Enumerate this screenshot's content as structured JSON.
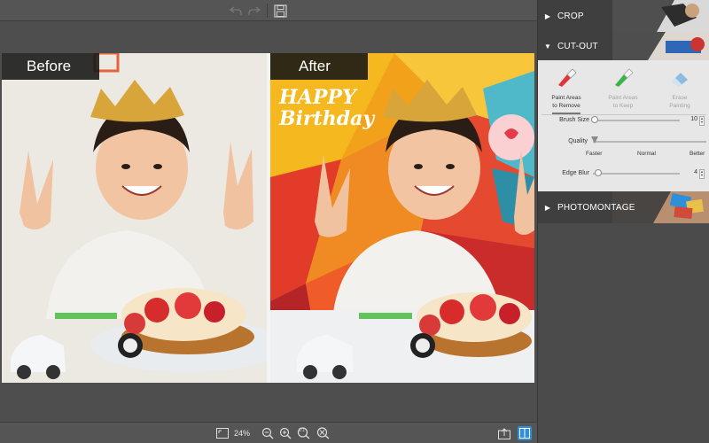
{
  "toolbar": {
    "undo_icon": "undo-icon",
    "redo_icon": "redo-icon",
    "save_icon": "save-icon"
  },
  "canvas": {
    "before_label": "Before",
    "after_label": "After",
    "after_bg_text": "HAPPY Birthday"
  },
  "bottombar": {
    "zoom": "24%",
    "fit_label": "1:1"
  },
  "sidebar": {
    "crop": {
      "title": "CROP"
    },
    "cutout": {
      "title": "CUT-OUT",
      "tools": [
        {
          "line1": "Paint Areas",
          "line2": "to Remove",
          "color": "#e2323a"
        },
        {
          "line1": "Paint Areas",
          "line2": "to Keep",
          "color": "#39b54a"
        },
        {
          "line1": "Erase",
          "line2": "Painting",
          "color": "#8fb9e0"
        }
      ],
      "brush_size_label": "Brush Size",
      "brush_size_value": "10",
      "quality_label": "Quality",
      "quality_options": [
        "Faster",
        "Normal",
        "Better"
      ],
      "edge_blur_label": "Edge Blur",
      "edge_blur_value": "4"
    },
    "photomontage": {
      "title": "PHOTOMONTAGE"
    }
  },
  "colors": {
    "panel_bg": "#e7e7e7",
    "header_bg": "#3f3f3f",
    "accent_blue": "#2f8fd8"
  }
}
